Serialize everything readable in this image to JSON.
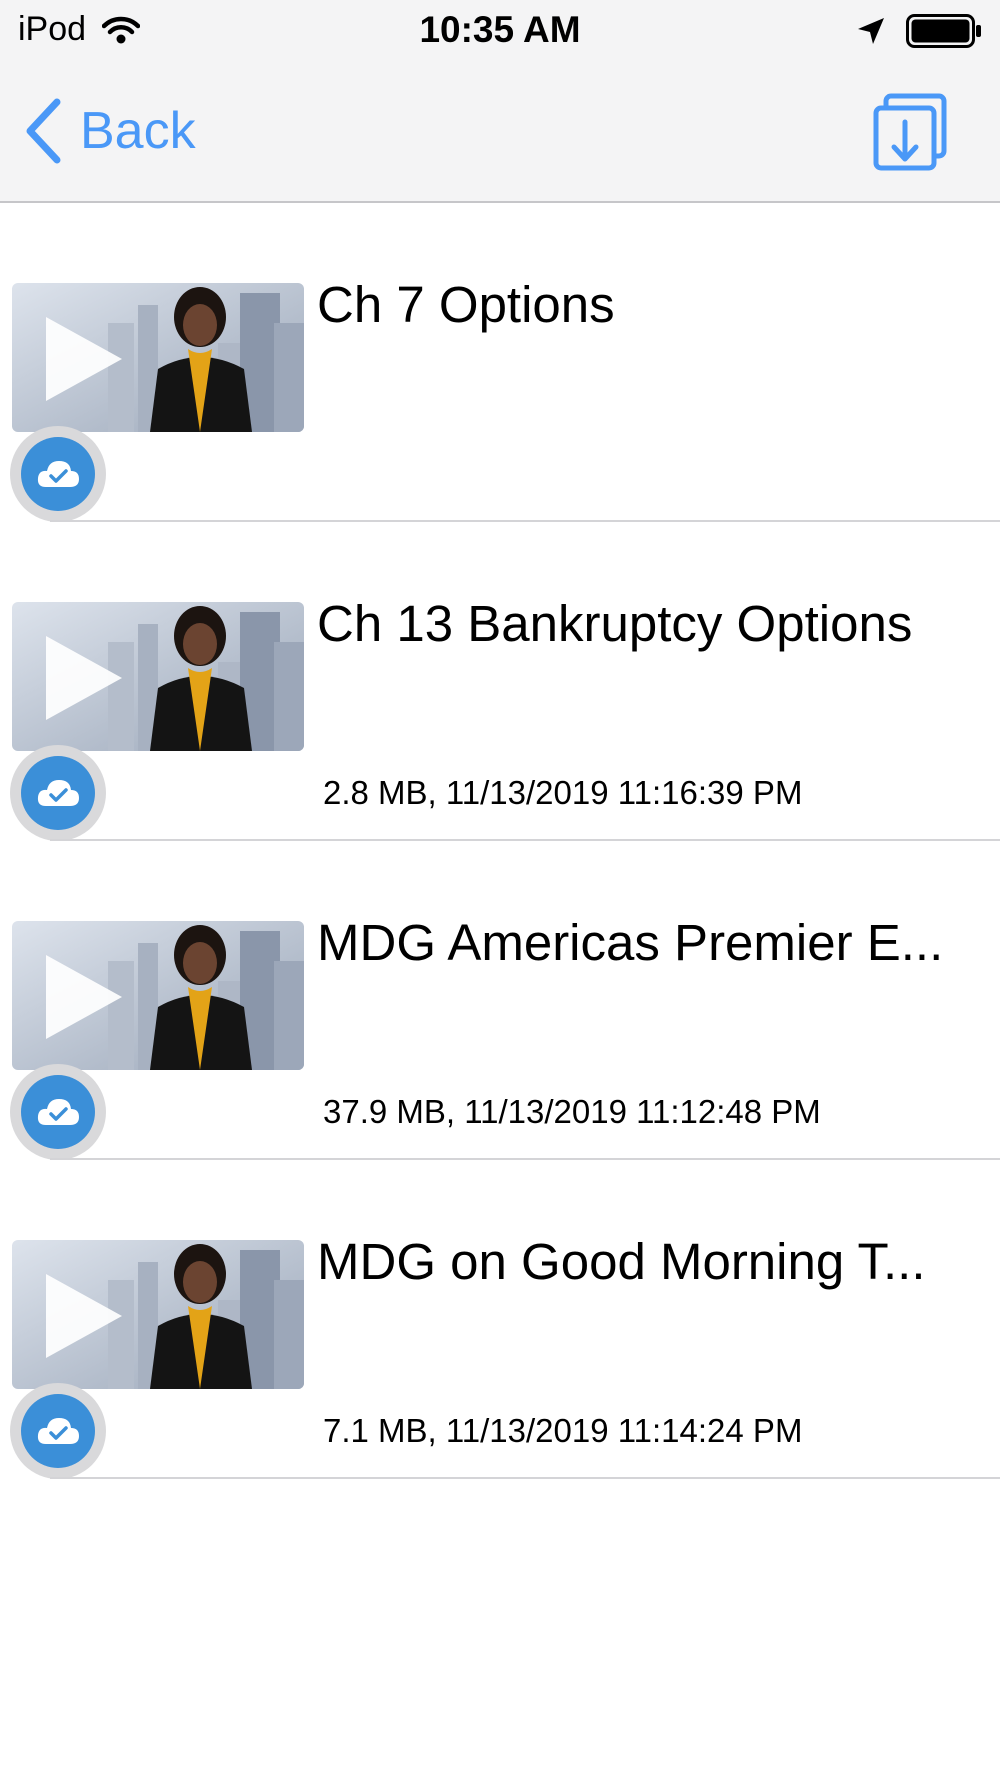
{
  "status_bar": {
    "carrier": "iPod",
    "time": "10:35 AM",
    "icons": [
      "wifi-icon",
      "location-arrow-icon",
      "battery-icon"
    ]
  },
  "nav": {
    "back_label": "Back",
    "download_icon": "download-icon"
  },
  "colors": {
    "accent": "#4a98f7",
    "cloud_badge": "#3b8fd8",
    "separator": "#d4d4d7",
    "bar_bg": "#f4f4f5"
  },
  "items": [
    {
      "title": "Ch 7 Options",
      "meta": "",
      "thumbnail_icon": "video-play-icon",
      "badge_icon": "cloud-check-icon"
    },
    {
      "title": "Ch 13 Bankruptcy Options",
      "meta": "2.8 MB, 11/13/2019 11:16:39 PM",
      "thumbnail_icon": "video-play-icon",
      "badge_icon": "cloud-check-icon"
    },
    {
      "title": "MDG Americas Premier E...",
      "meta": "37.9 MB, 11/13/2019 11:12:48 PM",
      "thumbnail_icon": "video-play-icon",
      "badge_icon": "cloud-check-icon"
    },
    {
      "title": "MDG on Good Morning T...",
      "meta": "7.1 MB, 11/13/2019 11:14:24 PM",
      "thumbnail_icon": "video-play-icon",
      "badge_icon": "cloud-check-icon"
    }
  ]
}
